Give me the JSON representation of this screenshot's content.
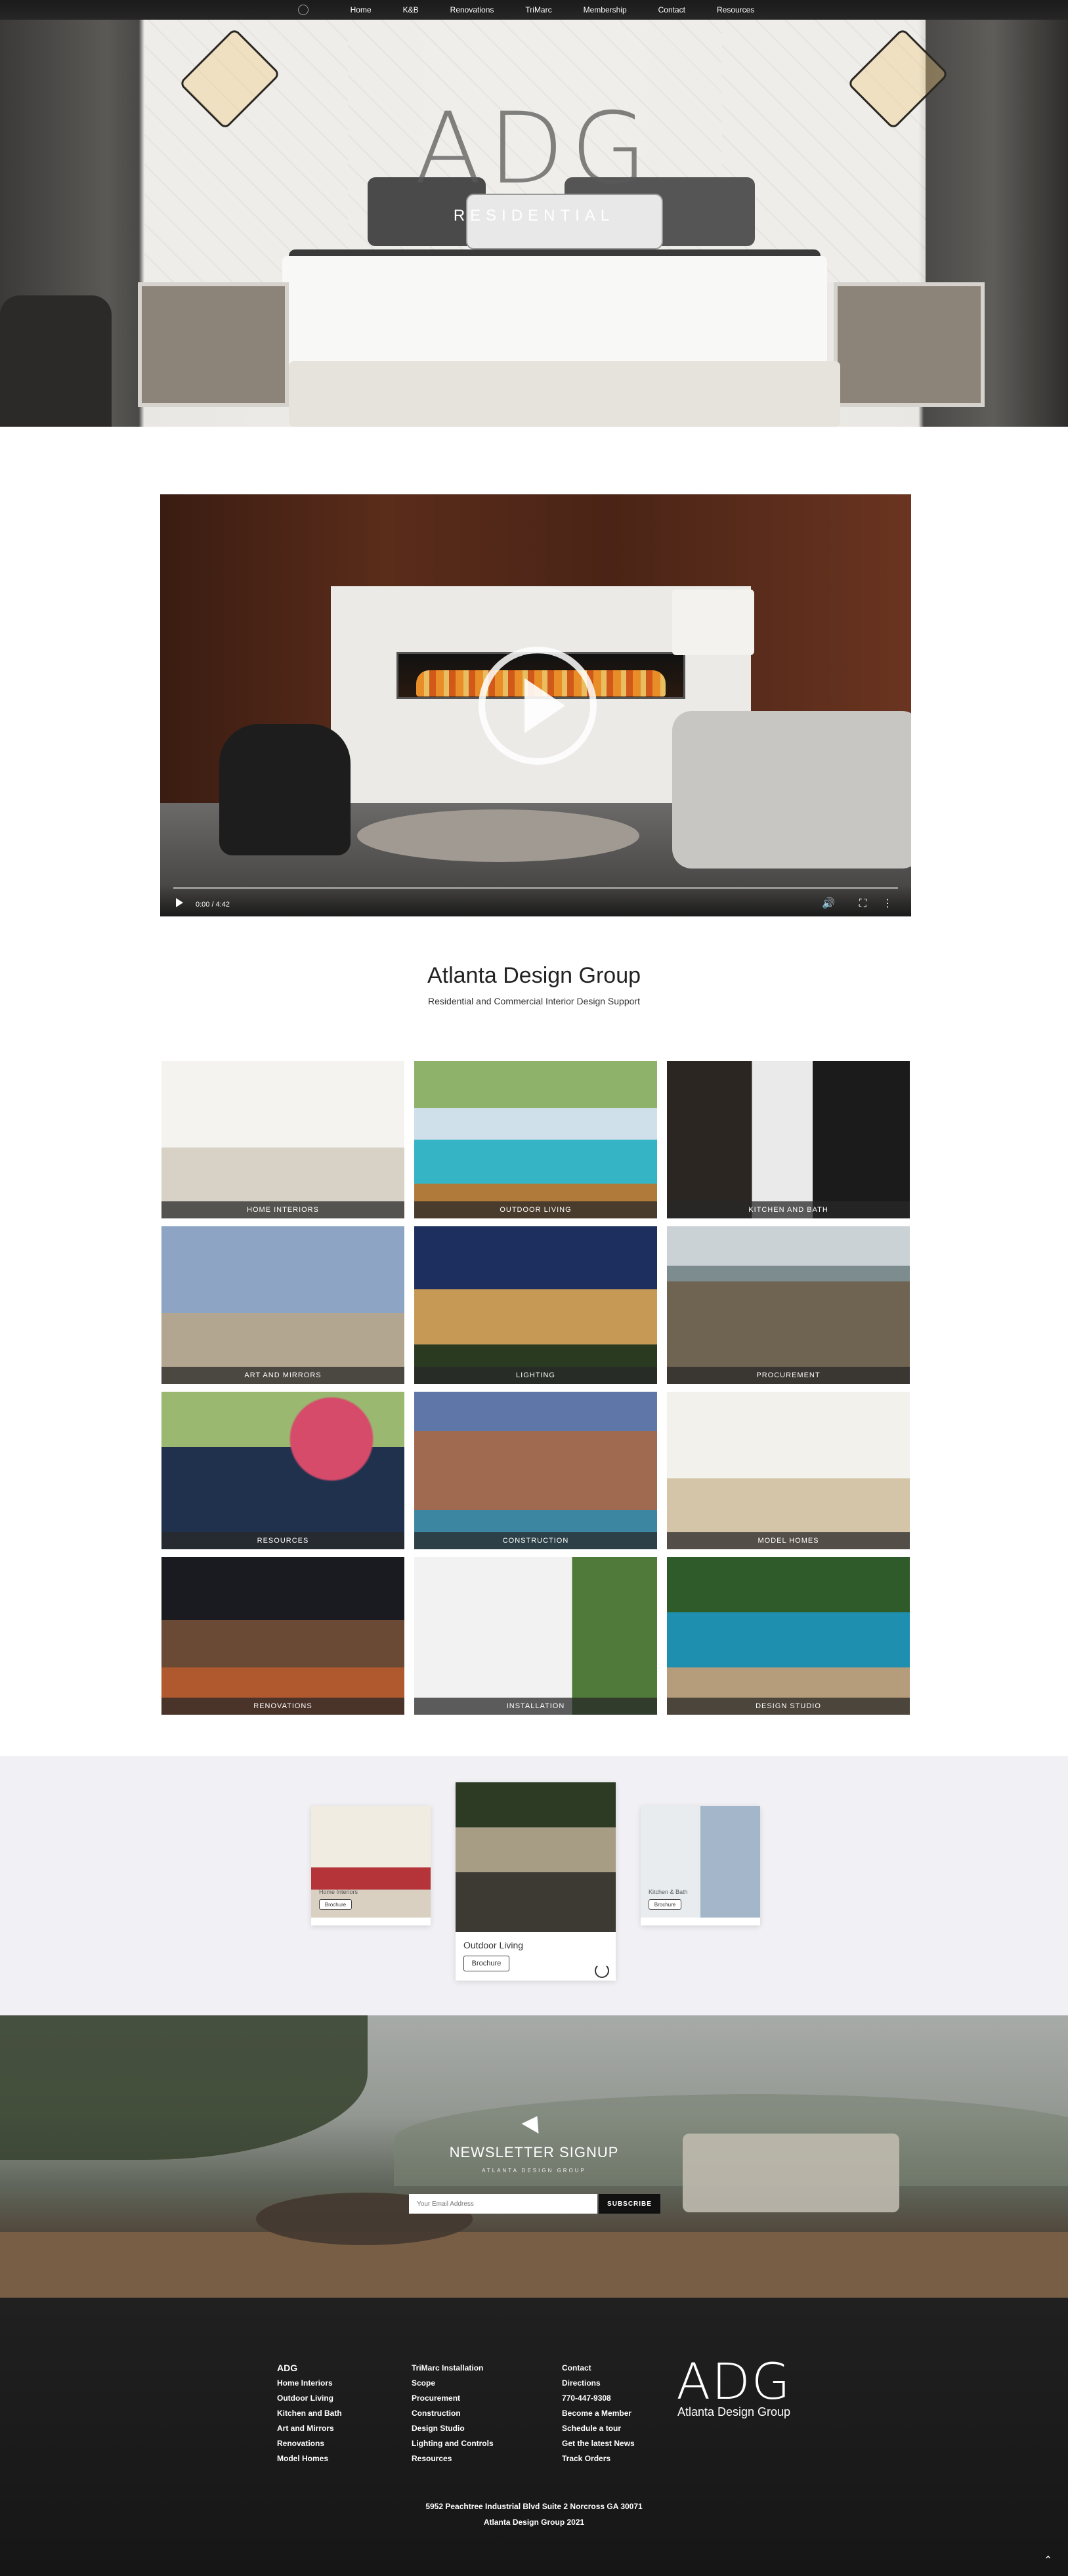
{
  "nav": {
    "items": [
      "Home",
      "K&B",
      "Renovations",
      "TriMarc",
      "Membership",
      "Contact",
      "Resources"
    ]
  },
  "hero": {
    "title": "ADG",
    "subtitle": "RESIDENTIAL"
  },
  "video": {
    "time": "0:00 / 4:42",
    "volume_icon": "volume-icon",
    "fullscreen_icon": "fullscreen-icon",
    "more_icon": "more-vertical-icon"
  },
  "intro": {
    "title": "Atlanta Design Group",
    "subtitle": "Residential and Commercial Interior Design Support"
  },
  "tiles": [
    {
      "label": "HOME INTERIORS"
    },
    {
      "label": "OUTDOOR LIVING"
    },
    {
      "label": "KITCHEN AND BATH"
    },
    {
      "label": "ART AND MIRRORS"
    },
    {
      "label": "LIGHTING"
    },
    {
      "label": "PROCUREMENT"
    },
    {
      "label": "RESOURCES"
    },
    {
      "label": "CONSTRUCTION"
    },
    {
      "label": "MODEL HOMES"
    },
    {
      "label": "RENOVATIONS"
    },
    {
      "label": "INSTALLATION"
    },
    {
      "label": "DESIGN STUDIO"
    }
  ],
  "brochures": [
    {
      "name": "Home Interiors",
      "button": "Brochure"
    },
    {
      "name": "Outdoor Living",
      "button": "Brochure"
    },
    {
      "name": "Kitchen & Bath",
      "button": "Brochure"
    }
  ],
  "newsletter": {
    "title": "NEWSLETTER SIGNUP",
    "subtitle": "ATLANTA DESIGN GROUP",
    "placeholder": "Your Email Address",
    "button": "SUBSCRIBE"
  },
  "footer": {
    "col1": [
      "ADG",
      "Home Interiors",
      "Outdoor Living",
      "Kitchen and Bath",
      "Art and Mirrors",
      "Renovations",
      "Model Homes"
    ],
    "col2": [
      "TriMarc Installation",
      "Scope",
      "Procurement",
      "Construction",
      "Design Studio",
      "Lighting and Controls",
      "Resources"
    ],
    "col3": [
      "Contact",
      "Directions",
      "770-447-9308",
      "Become a Member",
      "Schedule a tour",
      "Get the latest News",
      "Track Orders"
    ],
    "logo_mark": "ADG",
    "logo_text": "Atlanta Design Group",
    "address": "5952 Peachtree Industrial Blvd Suite 2 Norcross GA 30071",
    "copyright": "Atlanta Design Group 2021",
    "top_icon": "chevron-up-icon"
  },
  "colors": {
    "nav_bg": "#1f1f1f",
    "footer_bg": "#1b1b1b",
    "brochure_band": "#f1f0f4",
    "caption_bg": "#3a3a3a"
  }
}
